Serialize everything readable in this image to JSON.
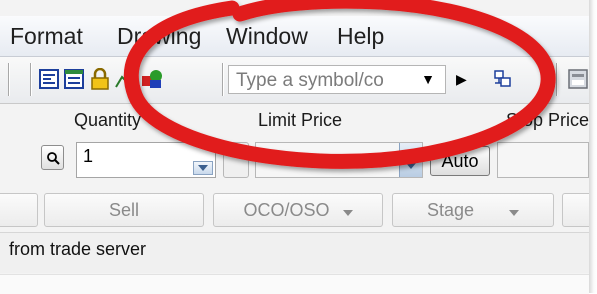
{
  "menu": {
    "items": [
      "Format",
      "Drawing",
      "Window",
      "Help"
    ]
  },
  "toolbar": {
    "symbol_input": {
      "placeholder": "Type a symbol/co"
    }
  },
  "order_entry": {
    "quantity_label": "Quantity",
    "quantity_value": "1",
    "limit_price_label": "Limit Price",
    "stop_price_label": "Stop Price",
    "auto_button_label": "Auto"
  },
  "actions": {
    "sell_label": "Sell",
    "oco_oso_label": "OCO/OSO",
    "stage_label": "Stage"
  },
  "status": {
    "message": "from trade server"
  },
  "colors": {
    "annotation_circle": "#e11a1a",
    "menu_bg": "#eef1f6"
  }
}
